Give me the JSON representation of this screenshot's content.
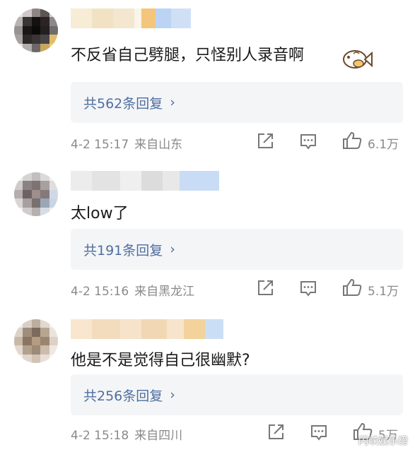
{
  "comments": [
    {
      "text": "不反省自己劈腿，只怪别人录音啊",
      "reply_label": "共562条回复",
      "date": "4-2 15:17",
      "location": "来自山东",
      "likes": "6.1万"
    },
    {
      "text": "太low了",
      "reply_label": "共191条回复",
      "date": "4-2 15:16",
      "location": "来自黑龙江",
      "likes": "5.1万"
    },
    {
      "text": "他是不是觉得自己很幽默?",
      "reply_label": "共256条回复",
      "date": "4-2 15:18",
      "location": "来自四川",
      "likes": "5万"
    }
  ],
  "icons": {
    "share": "share-icon",
    "comment": "comment-icon",
    "like": "thumbs-up-icon",
    "chevron": "chevron-right-icon",
    "emoji": "fish-emoji-icon"
  },
  "colors": {
    "reply_link": "#4e6ea0",
    "meta_gray": "#8a8a8a",
    "reply_bg": "#f4f5f7"
  },
  "watermark": "闪峡娱乐榜"
}
